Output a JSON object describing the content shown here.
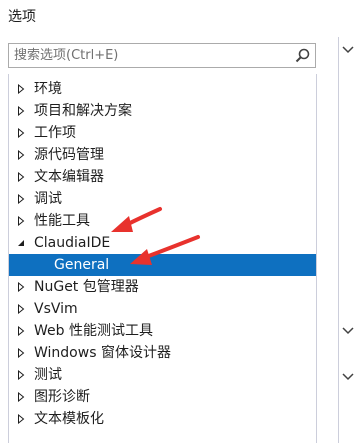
{
  "dialog": {
    "title": "选项"
  },
  "search": {
    "placeholder": "搜索选项(Ctrl+E)"
  },
  "tree": {
    "items": [
      {
        "label": "环境"
      },
      {
        "label": "项目和解决方案"
      },
      {
        "label": "工作项"
      },
      {
        "label": "源代码管理"
      },
      {
        "label": "文本编辑器"
      },
      {
        "label": "调试"
      },
      {
        "label": "性能工具"
      },
      {
        "label": "ClaudiaIDE"
      },
      {
        "label": "General"
      },
      {
        "label": "NuGet 包管理器"
      },
      {
        "label": "VsVim"
      },
      {
        "label": "Web 性能测试工具"
      },
      {
        "label": "Windows 窗体设计器"
      },
      {
        "label": "测试"
      },
      {
        "label": "图形诊断"
      },
      {
        "label": "文本模板化"
      }
    ]
  },
  "colors": {
    "selection": "#0e70c0",
    "annotation_arrow": "#e8322d",
    "border": "#cccedb"
  },
  "icons": {
    "search": "search-icon",
    "collapsed": "triangle-right-icon",
    "expanded": "triangle-down-icon",
    "scroll_chevron": "chevron-down-icon"
  }
}
